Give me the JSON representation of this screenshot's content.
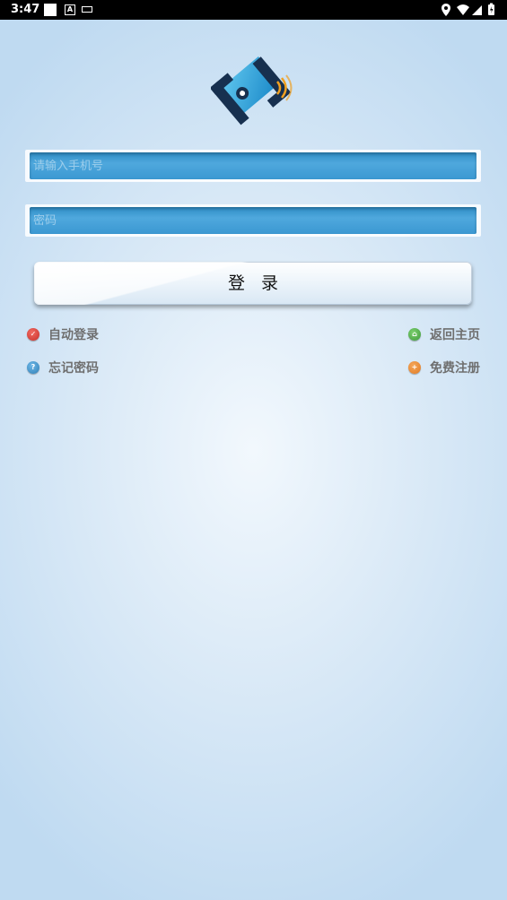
{
  "status_bar": {
    "time": "3:47",
    "a_icon": "A"
  },
  "login": {
    "phone_placeholder": "请输入手机号",
    "password_placeholder": "密码",
    "login_button": "登录"
  },
  "links": {
    "auto_login": "自动登录",
    "back_home": "返回主页",
    "forgot_password": "忘记密码",
    "free_register": "免费注册"
  },
  "colors": {
    "input_fill": "#3b98d2",
    "auto_login_icon": "#c8302a",
    "back_home_icon": "#3f9a3c",
    "forgot_password_icon": "#2f7fb5",
    "free_register_icon": "#e07a22"
  }
}
